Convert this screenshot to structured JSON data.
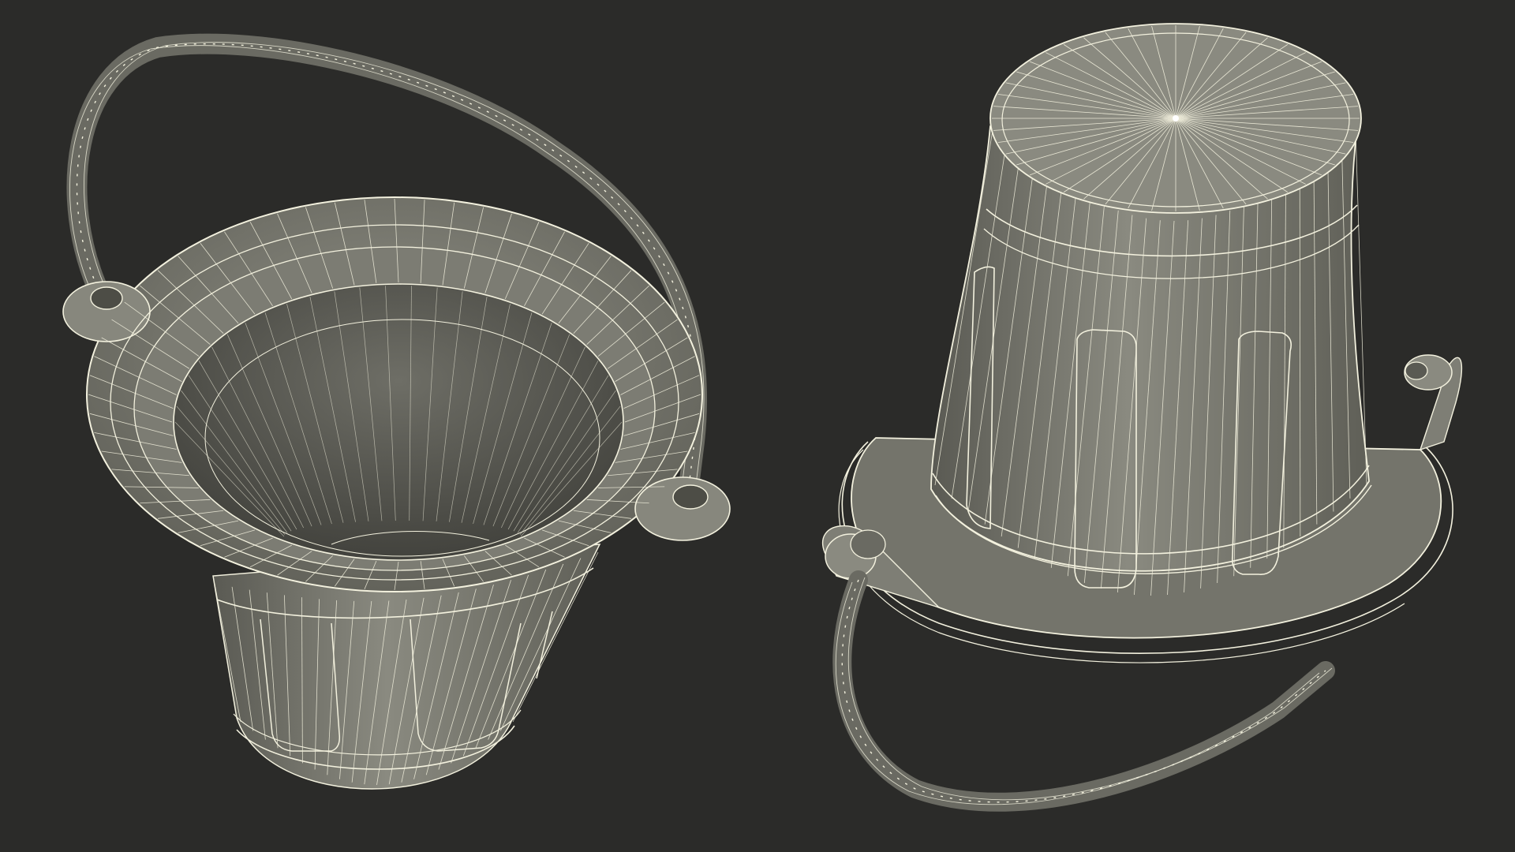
{
  "scene": {
    "background_color": "#2b2b29",
    "surface_color": "#85857b",
    "surface_shadow_color": "#5f5f57",
    "wire_color": "#f3f1de",
    "views": [
      {
        "name": "bucket-upright-view",
        "orientation": "upright"
      },
      {
        "name": "bucket-inverted-view",
        "orientation": "upside-down"
      }
    ]
  }
}
